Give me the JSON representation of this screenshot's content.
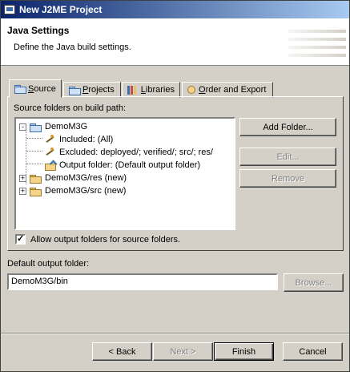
{
  "window": {
    "title": "New J2ME Project"
  },
  "header": {
    "title": "Java Settings",
    "description": "Define the Java build settings."
  },
  "tabs": [
    {
      "label": "Source",
      "mnemonic": "S",
      "rest": "ource"
    },
    {
      "label": "Projects",
      "mnemonic": "P",
      "rest": "rojects"
    },
    {
      "label": "Libraries",
      "mnemonic": "L",
      "rest": "ibraries"
    },
    {
      "label": "Order and Export",
      "mnemonic": "O",
      "rest": "rder and Export"
    }
  ],
  "source": {
    "label": "Source folders on build path:",
    "tree": [
      {
        "text": "DemoM3G",
        "expander": "-"
      },
      {
        "text": "Included: (All)"
      },
      {
        "text": "Excluded: deployed/; verified/; src/; res/"
      },
      {
        "text": "Output folder: (Default output folder)"
      },
      {
        "text": "DemoM3G/res (new)",
        "expander": "+"
      },
      {
        "text": "DemoM3G/src (new)",
        "expander": "+"
      }
    ],
    "buttons": {
      "add_folder": "Add Folder...",
      "edit": "Edit...",
      "remove": "Remove"
    },
    "allow_checkbox": {
      "label": "Allow output folders for source folders.",
      "checked": true
    }
  },
  "output": {
    "label": "Default output folder:",
    "value": "DemoM3G/bin",
    "browse": "Browse..."
  },
  "footer": {
    "back": "< Back",
    "next": "Next >",
    "finish": "Finish",
    "cancel": "Cancel"
  },
  "icons": [
    "app-icon",
    "folder-icon",
    "filter-icon",
    "output-folder-icon",
    "libraries-icon",
    "order-icon"
  ]
}
